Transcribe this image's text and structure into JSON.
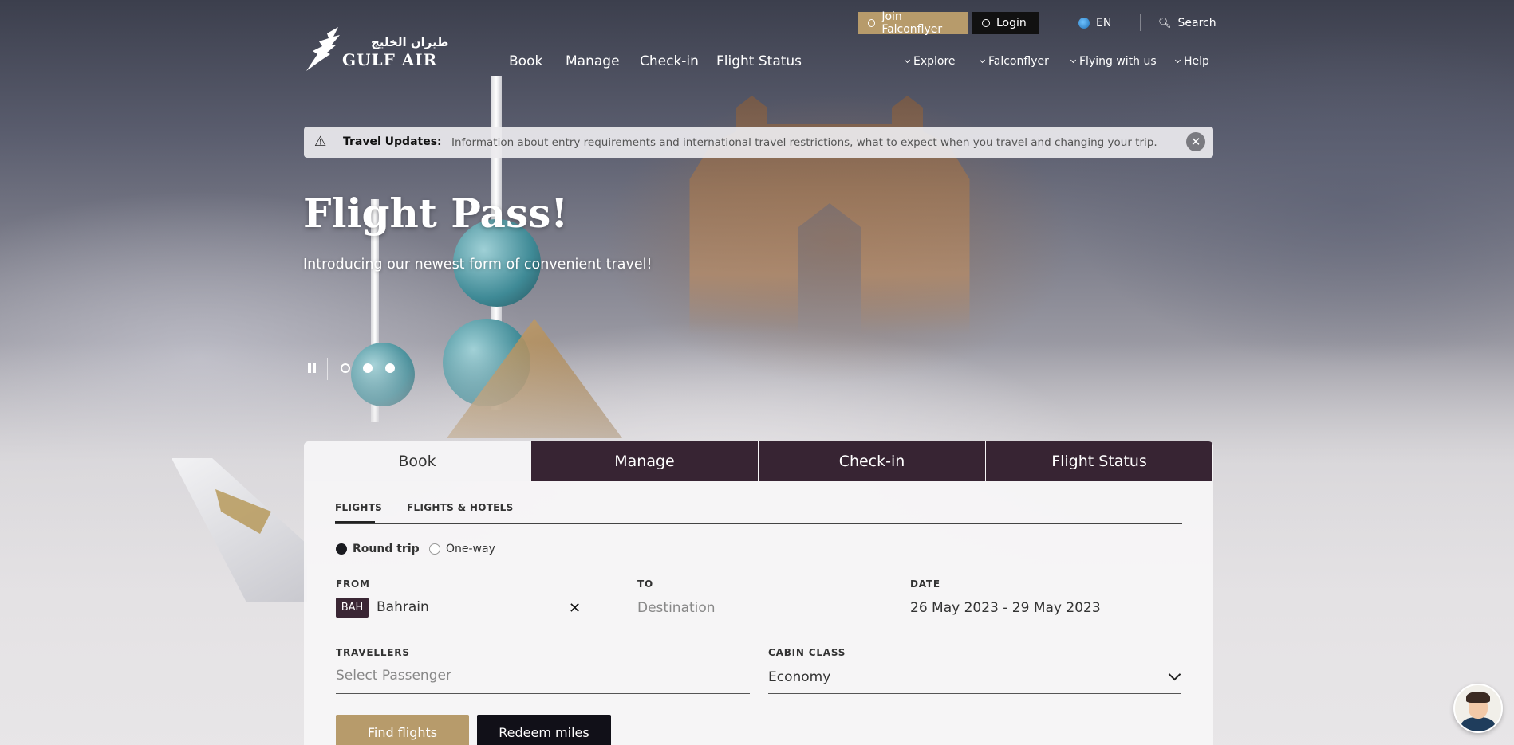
{
  "utility": {
    "join_label": "Join Falconflyer",
    "login_label": "Login",
    "language": "EN",
    "search_label": "Search"
  },
  "logo": {
    "arabic": "طيران الخليج",
    "name": "GULF AIR"
  },
  "nav": {
    "main": [
      "Book",
      "Manage",
      "Check-in",
      "Flight Status"
    ],
    "right": [
      "Explore",
      "Falconflyer",
      "Flying with us",
      "Help"
    ]
  },
  "travel_updates": {
    "label": "Travel Updates:",
    "text": "Information about entry requirements and international travel restrictions, what to expect when you travel and changing your trip."
  },
  "hero": {
    "title": "Flight Pass!",
    "subtitle": "Introducing our newest form of convenient travel!",
    "carousel": {
      "total": 3,
      "active": 1
    }
  },
  "booking": {
    "tabs": [
      "Book",
      "Manage",
      "Check-in",
      "Flight Status"
    ],
    "active_tab": "Book",
    "subtabs": [
      "FLIGHTS",
      "FLIGHTS & HOTELS"
    ],
    "trip_types": [
      "Round trip",
      "One-way"
    ],
    "selected_trip": "Round trip",
    "from": {
      "label": "FROM",
      "code": "BAH",
      "value": "Bahrain"
    },
    "to": {
      "label": "TO",
      "placeholder": "Destination"
    },
    "date": {
      "label": "DATE",
      "value": "26 May 2023 - 29 May 2023"
    },
    "travellers": {
      "label": "TRAVELLERS",
      "placeholder": "Select Passenger"
    },
    "cabin": {
      "label": "CABIN CLASS",
      "value": "Economy"
    },
    "find_label": "Find flights",
    "redeem_label": "Redeem miles"
  },
  "colors": {
    "gold": "#b79b6b",
    "plum": "#372433",
    "dark": "#111018"
  }
}
